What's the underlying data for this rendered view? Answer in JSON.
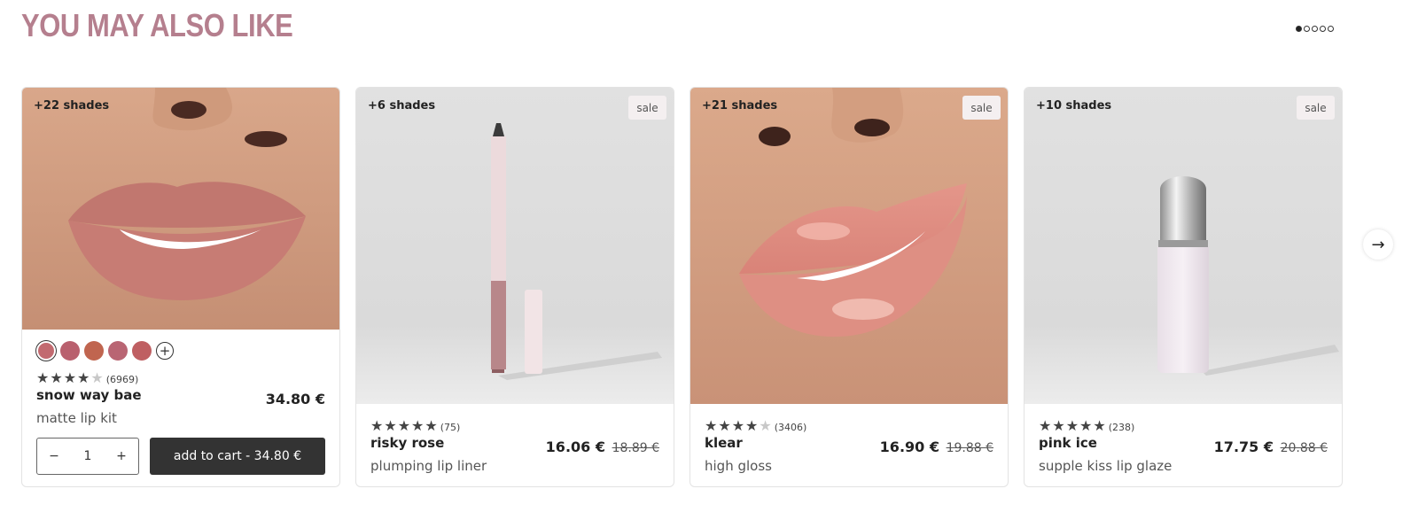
{
  "section": {
    "title": "YOU MAY ALSO LIKE"
  },
  "pager": {
    "total": 5,
    "active": 1
  },
  "products": [
    {
      "shades": "+22 shades",
      "sale": "",
      "rating": 4,
      "review_count": "(6969)",
      "name": "snow way bae",
      "type": "matte lip kit",
      "price": "34.80 €",
      "old_price": "",
      "swatch_colors": [
        "#c26a70",
        "#b9606e",
        "#c0654f",
        "#b96573",
        "#bf5f62"
      ],
      "quantity": "1",
      "qty_minus": "−",
      "qty_plus": "+",
      "cart_label": "add to cart - 34.80 €"
    },
    {
      "shades": "+6 shades",
      "sale": "sale",
      "rating": 5,
      "review_count": "(75)",
      "name": "risky rose",
      "type": "plumping lip liner",
      "price": "16.06 €",
      "old_price": "18.89 €"
    },
    {
      "shades": "+21 shades",
      "sale": "sale",
      "rating": 4,
      "review_count": "(3406)",
      "name": "klear",
      "type": "high gloss",
      "price": "16.90 €",
      "old_price": "19.88 €"
    },
    {
      "shades": "+10 shades",
      "sale": "sale",
      "rating": 5,
      "review_count": "(238)",
      "name": "pink ice",
      "type": "supple kiss lip glaze",
      "price": "17.75 €",
      "old_price": "20.88 €"
    }
  ],
  "icons": {
    "next": "arrow-right-icon",
    "more_swatches": "plus-icon"
  },
  "colors": {
    "title": "#b57f8e",
    "button": "#333333"
  }
}
